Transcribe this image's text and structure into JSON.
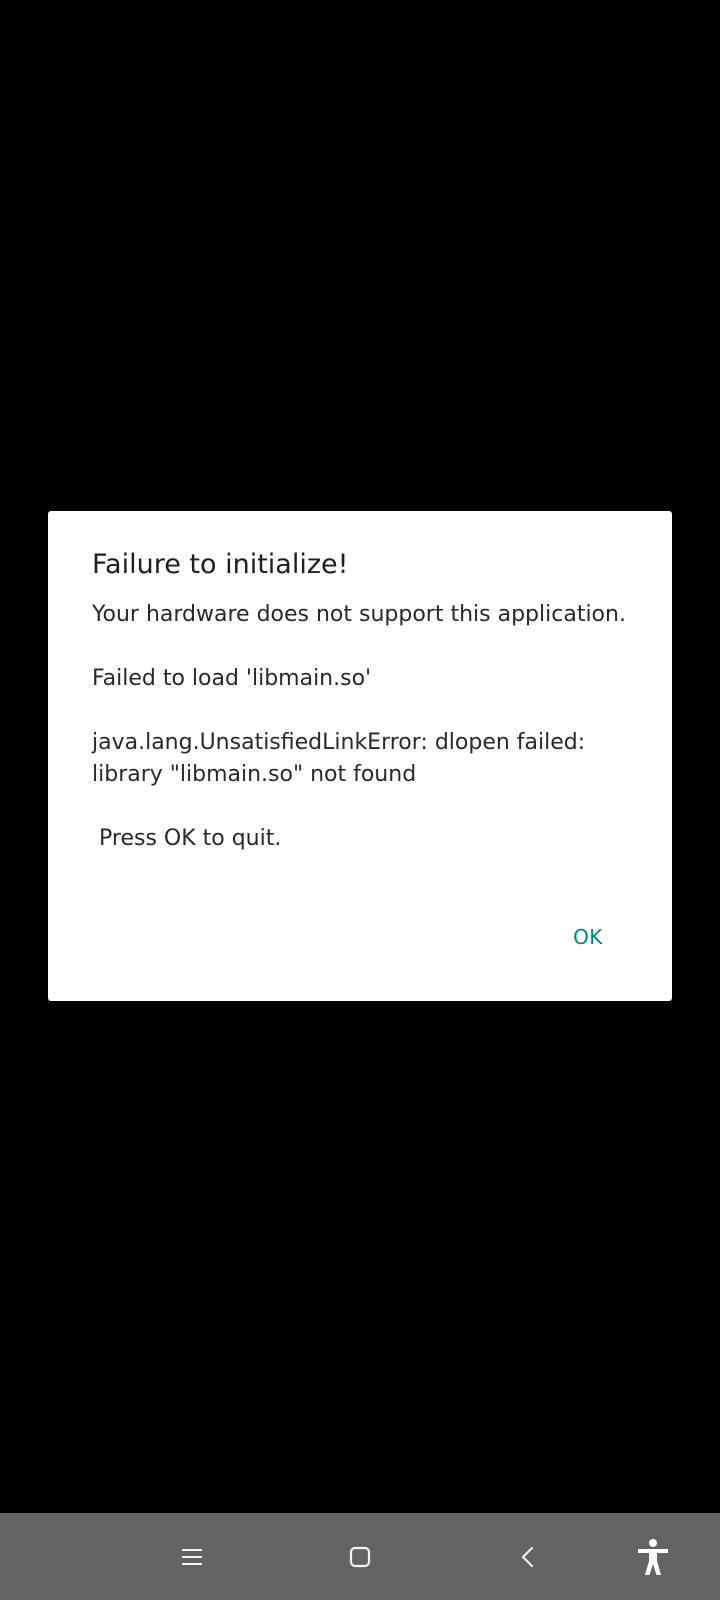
{
  "dialog": {
    "title": "Failure to initialize!",
    "message": "Your hardware does not support this application.\n\nFailed to load 'libmain.so'\n\njava.lang.UnsatisfiedLinkError: dlopen failed: library \"libmain.so\" not found\n\n Press OK to quit.",
    "ok_label": "OK"
  },
  "navbar": {
    "icons": [
      "menu-icon",
      "home-icon",
      "back-icon",
      "accessibility-icon"
    ]
  },
  "colors": {
    "background": "#000000",
    "dialog": "#ffffff",
    "accent": "#00877a",
    "navbar": "#636363"
  }
}
